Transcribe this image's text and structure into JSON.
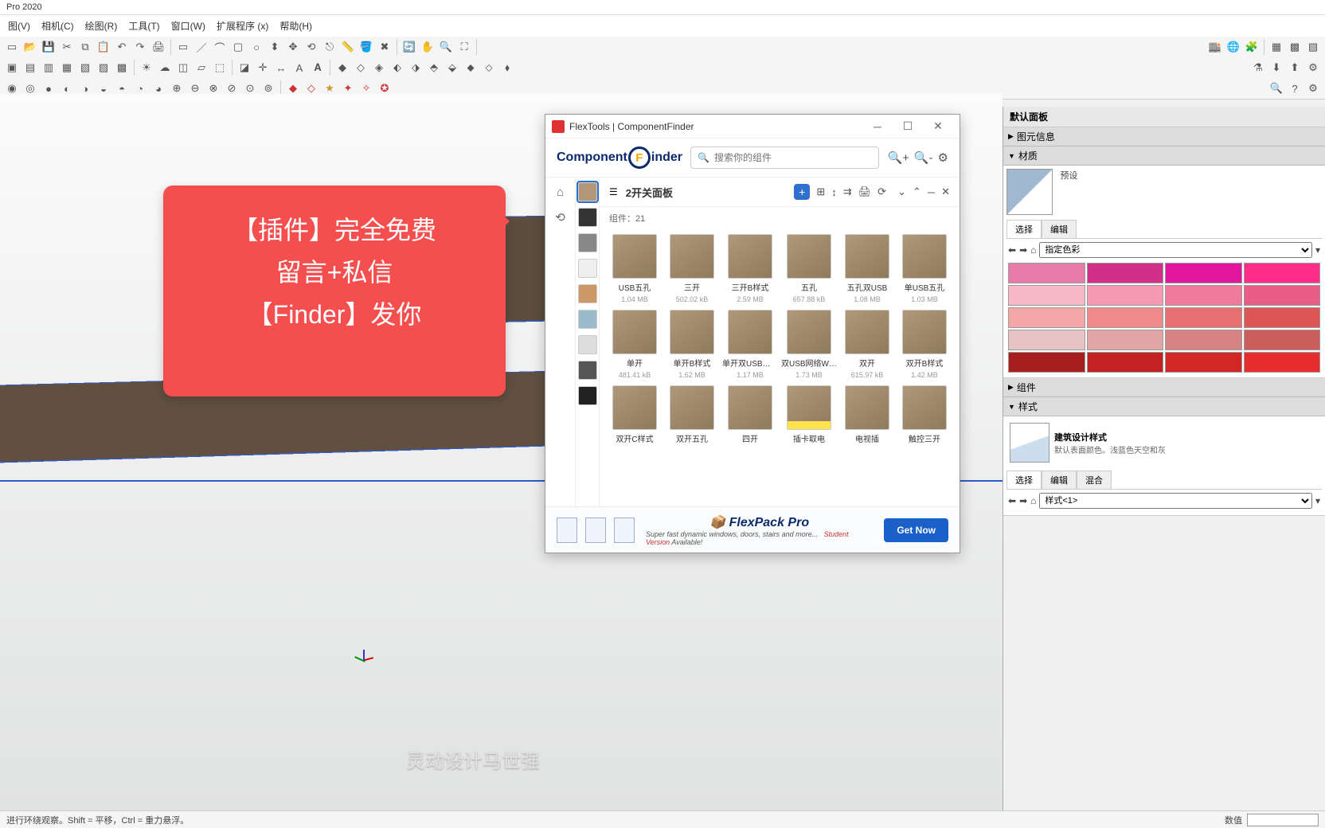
{
  "app": {
    "title": "Pro 2020"
  },
  "menu": [
    "图(V)",
    "相机(C)",
    "绘图(R)",
    "工具(T)",
    "窗口(W)",
    "扩展程序 (x)",
    "帮助(H)"
  ],
  "callout": {
    "line1": "【插件】完全免费",
    "line2": "留言+私信",
    "line3": "【Finder】发你"
  },
  "subtitle": "灵动设计马世强",
  "statusbar": {
    "hint": "进行环绕观察。Shift = 平移，Ctrl = 重力悬浮。",
    "measure_label": "数值"
  },
  "flex": {
    "window_title": "FlexTools | ComponentFinder",
    "logo_component": "Component",
    "logo_finder": "inder",
    "search_placeholder": "搜索你的组件",
    "breadcrumb": "2开关面板",
    "count_label": "组件：",
    "count_value": "21",
    "components": [
      {
        "name": "USB五孔",
        "size": "1.04 MB"
      },
      {
        "name": "三开",
        "size": "502.02 kB"
      },
      {
        "name": "三开B样式",
        "size": "2.59 MB"
      },
      {
        "name": "五孔",
        "size": "657.88 kB"
      },
      {
        "name": "五孔双USB",
        "size": "1.08 MB"
      },
      {
        "name": "单USB五孔",
        "size": "1.03 MB"
      },
      {
        "name": "单开",
        "size": "481.41 kB"
      },
      {
        "name": "单开B样式",
        "size": "1.62 MB"
      },
      {
        "name": "单开双USB五孔",
        "size": "1.17 MB"
      },
      {
        "name": "双USB网络WiFi",
        "size": "1.73 MB"
      },
      {
        "name": "双开",
        "size": "615.97 kB"
      },
      {
        "name": "双开B样式",
        "size": "1.42 MB"
      },
      {
        "name": "双开C样式",
        "size": ""
      },
      {
        "name": "双开五孔",
        "size": ""
      },
      {
        "name": "四开",
        "size": ""
      },
      {
        "name": "插卡取电",
        "size": ""
      },
      {
        "name": "电视插",
        "size": ""
      },
      {
        "name": "触控三开",
        "size": ""
      }
    ],
    "footer": {
      "title": "FlexPack Pro",
      "subtitle": "Super fast dynamic windows, doors, stairs and more...",
      "student": "Student Version",
      "available": " Available!",
      "get_now": "Get Now"
    }
  },
  "tray": {
    "title": "默认面板",
    "entity_info": "图元信息",
    "materials": "材质",
    "mat_default": "预设",
    "tab_select": "选择",
    "tab_edit": "编辑",
    "color_mode": "指定色彩",
    "swatches_row1": [
      "#e77aa8",
      "#d12f8a",
      "#e0169c",
      "#ff2d8a"
    ],
    "swatches_row2": [
      "#f7b9c5",
      "#f59ab0",
      "#ef7a99",
      "#e85d86"
    ],
    "swatches_row3": [
      "#f4a7a7",
      "#ee8a8a",
      "#e77070",
      "#de5555"
    ],
    "swatches_row4": [
      "#e6c4c4",
      "#e0a5a5",
      "#d88383",
      "#cc5d5d"
    ],
    "swatches_row5": [
      "#a81e1e",
      "#c22222",
      "#d12727",
      "#e62e2e"
    ],
    "components": "组件",
    "styles": "样式",
    "style_name": "建筑设计样式",
    "style_desc": "默认表面颜色。浅蓝色天空和灰",
    "style_select": "样式<1>",
    "tab_mix": "混合"
  }
}
